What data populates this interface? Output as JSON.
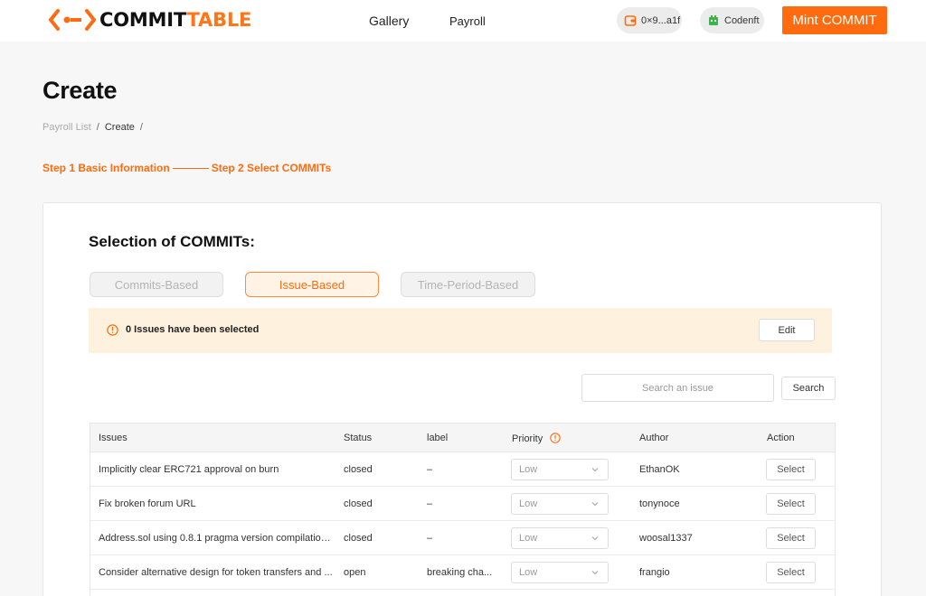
{
  "header": {
    "logo_left": "COMMIT",
    "logo_right": "TABLE",
    "nav": [
      "Gallery",
      "Payroll"
    ],
    "wallet": "0×9...a1f",
    "account": "Codenft",
    "mint_label": "Mint COMMIT"
  },
  "page": {
    "title": "Create",
    "breadcrumb": [
      "Payroll List",
      "Create"
    ],
    "step1": "Step 1 Basic Information",
    "step2": "Step 2 Select COMMITs"
  },
  "selection": {
    "title": "Selection of COMMITs:",
    "modes": [
      "Commits-Based",
      "Issue-Based",
      "Time-Period-Based"
    ],
    "active_mode": "Issue-Based",
    "notice": "0 Issues have been selected",
    "edit_label": "Edit",
    "search_placeholder": "Search an issue",
    "search_label": "Search"
  },
  "table": {
    "columns": [
      "Issues",
      "Status",
      "label",
      "Priority",
      "Author",
      "Action"
    ],
    "rows": [
      {
        "issue": "Implicitly clear ERC721 approval on burn",
        "status": "closed",
        "label": "–",
        "priority": "Low",
        "author": "EthanOK",
        "action": "Select"
      },
      {
        "issue": "Fix broken forum URL",
        "status": "closed",
        "label": "–",
        "priority": "Low",
        "author": "tonynoce",
        "action": "Select"
      },
      {
        "issue": "Address.sol using 0.8.1 pragma version compilation i...",
        "status": "closed",
        "label": "–",
        "priority": "Low",
        "author": "woosal1337",
        "action": "Select"
      },
      {
        "issue": "Consider alternative design for token transfers and ...",
        "status": "open",
        "label": "breaking cha...",
        "priority": "Low",
        "author": "frangio",
        "action": "Select"
      }
    ]
  },
  "colors": {
    "accent": "#ff6b0e",
    "notice_bg": "#fef1de",
    "background": "#f7f7f7"
  },
  "icons": [
    "logo-icon",
    "wallet-icon",
    "codenft-icon",
    "info-icon",
    "chevron-down-icon"
  ]
}
